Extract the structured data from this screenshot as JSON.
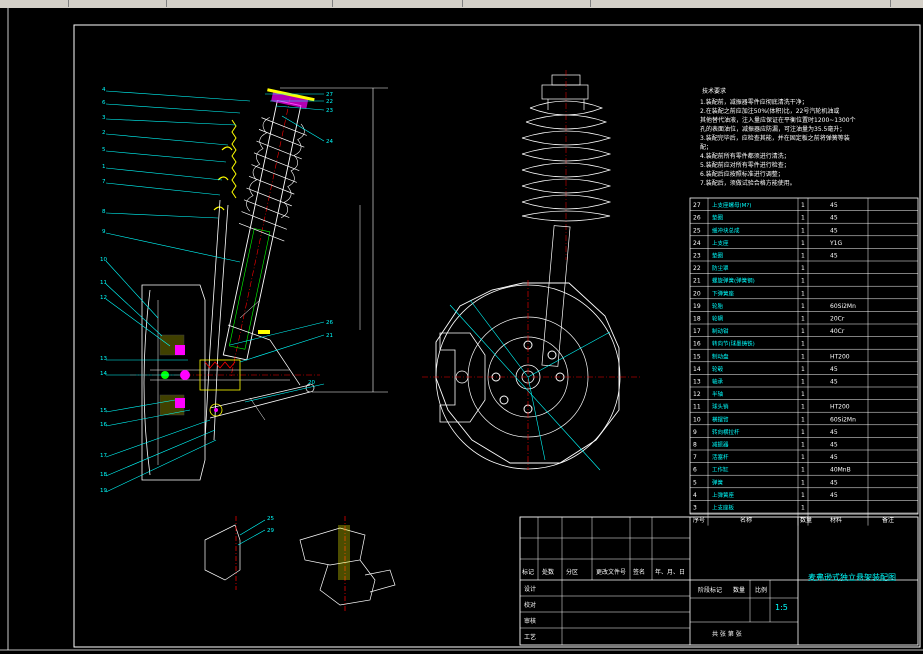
{
  "toolbar": {
    "tabs": [
      "",
      "",
      "",
      "",
      "",
      ""
    ]
  },
  "callouts": {
    "left": [
      "4",
      "6",
      "3",
      "2",
      "5",
      "1",
      "7",
      "8",
      "9",
      "10",
      "11",
      "12",
      "13",
      "14",
      "15",
      "16",
      "17",
      "18",
      "19"
    ],
    "right": [
      "27",
      "22",
      "23",
      "24",
      "26",
      "21",
      "20"
    ],
    "detail": [
      "25",
      "29"
    ]
  },
  "dimensions": {
    "length_label": ""
  },
  "tech_notes": {
    "title": "技术要求",
    "lines": [
      "1.装配前，减振器零件应彻底清洗干净；",
      "2.在装配之前应加注50%(体积)比，22号汽轮机油或",
      "   其他替代油液，注入量应保证在平衡位置时1200~1300个",
      "   孔的表面油位，减振器应防漏，可注油量为35.5毫升；",
      "3.装配完毕后，应检查其能，并在固定板之前将弹簧等装",
      "   配；",
      "4.装配前所有零件都须进行清洗；",
      "5.装配前应对所有零件进行检查；",
      "6.装配后应按照标准进行调整；",
      "7.装配后，须做试验合格方能使用。"
    ]
  },
  "parts_table": {
    "rows": [
      {
        "no": "27",
        "name": "上支座螺母(M?)",
        "qty": "1",
        "mat": "45"
      },
      {
        "no": "26",
        "name": "垫圈",
        "qty": "1",
        "mat": "45"
      },
      {
        "no": "25",
        "name": "缓冲块总成",
        "qty": "1",
        "mat": "45"
      },
      {
        "no": "24",
        "name": "上支座",
        "qty": "1",
        "mat": "Y1G"
      },
      {
        "no": "23",
        "name": "垫圈",
        "qty": "1",
        "mat": "45"
      },
      {
        "no": "22",
        "name": "防尘罩",
        "qty": "1",
        "mat": ""
      },
      {
        "no": "21",
        "name": "螺旋弹簧(弹簧钢)",
        "qty": "1",
        "mat": ""
      },
      {
        "no": "20",
        "name": "下弹簧座",
        "qty": "1",
        "mat": ""
      },
      {
        "no": "19",
        "name": "轮胎",
        "qty": "1",
        "mat": "60Si2Mn"
      },
      {
        "no": "18",
        "name": "轮辋",
        "qty": "1",
        "mat": "20Cr"
      },
      {
        "no": "17",
        "name": "制动钳",
        "qty": "1",
        "mat": "40Cr"
      },
      {
        "no": "16",
        "name": "转向节(球墨铸铁)",
        "qty": "1",
        "mat": ""
      },
      {
        "no": "15",
        "name": "制动盘",
        "qty": "1",
        "mat": "HT200"
      },
      {
        "no": "14",
        "name": "轮毂",
        "qty": "1",
        "mat": "45"
      },
      {
        "no": "13",
        "name": "轴承",
        "qty": "1",
        "mat": "45"
      },
      {
        "no": "12",
        "name": "半轴",
        "qty": "1",
        "mat": ""
      },
      {
        "no": "11",
        "name": "球头销",
        "qty": "1",
        "mat": "HT200"
      },
      {
        "no": "10",
        "name": "横摆臂",
        "qty": "1",
        "mat": "60Si2Mn"
      },
      {
        "no": "9",
        "name": "转向横拉杆",
        "qty": "1",
        "mat": "45"
      },
      {
        "no": "8",
        "name": "减振器",
        "qty": "1",
        "mat": "45"
      },
      {
        "no": "7",
        "name": "活塞杆",
        "qty": "1",
        "mat": "45"
      },
      {
        "no": "6",
        "name": "工作缸",
        "qty": "1",
        "mat": "40MnB"
      },
      {
        "no": "5",
        "name": "弹簧",
        "qty": "1",
        "mat": "45"
      },
      {
        "no": "4",
        "name": "上弹簧座",
        "qty": "1",
        "mat": "45"
      },
      {
        "no": "3",
        "name": "上支座板",
        "qty": "1",
        "mat": ""
      }
    ],
    "header": {
      "no": "序号",
      "name": "名称",
      "qty": "数量",
      "mat": "材料",
      "note": "备注"
    }
  },
  "title_block": {
    "drawing_title": "麦弗逊式独立悬架装配图",
    "scale": "1:5",
    "scale_label": "比例",
    "qty_label": "数量",
    "stage_label": "阶段标记",
    "sheet_text": "共 张 第 张",
    "rev_cols": [
      "标记",
      "处数",
      "分区",
      "更改文件号",
      "签名",
      "年、月、日"
    ],
    "roles": [
      "设计",
      "校对",
      "审核",
      "工艺"
    ]
  }
}
